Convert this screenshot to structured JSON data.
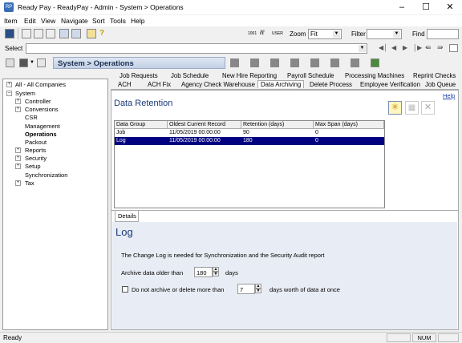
{
  "window": {
    "title": "Ready Pay - ReadyPay - Admin - System > Operations"
  },
  "menu": [
    "Item",
    "Edit",
    "View",
    "Navigate",
    "Sort",
    "Tools",
    "Help"
  ],
  "toolbar": {
    "zoom_label": "Zoom",
    "zoom_value": "Fit",
    "filter_label": "Filter",
    "filter_value": "",
    "find_label": "Find",
    "find_value": "",
    "id_badge": "1001",
    "user_badge": "USER"
  },
  "select_bar": {
    "label": "Select",
    "value": ""
  },
  "breadcrumb": "System > Operations",
  "tree": [
    {
      "label": "All - All Companies",
      "level": 0,
      "expander": "+"
    },
    {
      "label": "System",
      "level": 0,
      "expander": "-"
    },
    {
      "label": "Controller",
      "level": 1,
      "expander": "+"
    },
    {
      "label": "Conversions",
      "level": 1,
      "expander": "+"
    },
    {
      "label": "CSR",
      "level": 1,
      "expander": ""
    },
    {
      "label": "Management",
      "level": 1,
      "expander": ""
    },
    {
      "label": "Operations",
      "level": 1,
      "expander": "",
      "selected": true
    },
    {
      "label": "Packout",
      "level": 1,
      "expander": ""
    },
    {
      "label": "Reports",
      "level": 1,
      "expander": "+"
    },
    {
      "label": "Security",
      "level": 1,
      "expander": "+"
    },
    {
      "label": "Setup",
      "level": 1,
      "expander": "+"
    },
    {
      "label": "Synchronization",
      "level": 1,
      "expander": ""
    },
    {
      "label": "Tax",
      "level": 1,
      "expander": "+"
    }
  ],
  "tabs_top": [
    "Job Requests",
    "Job Schedule",
    "New Hire Reporting",
    "Payroll Schedule",
    "Processing Machines",
    "Reprint Checks"
  ],
  "tabs_bottom": [
    "ACH",
    "ACH Fix",
    "Agency Check Warehouse",
    "Data Archiving",
    "Delete Process",
    "Employee Verification",
    "Job Queue"
  ],
  "active_tab": "Data Archiving",
  "help_link": "Help",
  "section_title": "Data Retention",
  "grid": {
    "columns": [
      "Data Group",
      "Oldest Current Record",
      "Retention (days)",
      "Max Span (days)"
    ],
    "rows": [
      [
        "Job",
        "11/05/2019 00:00:00",
        "90",
        "0"
      ],
      [
        "Log",
        "11/05/2019 00:00:00",
        "180",
        "0"
      ]
    ],
    "selected_row": 1
  },
  "details": {
    "tab_label": "Details",
    "title": "Log",
    "description": "The Change Log is needed for Synchronization and the Security Audit report",
    "archive_label": "Archive data older than",
    "archive_value": "180",
    "archive_unit": "days",
    "checkbox_label": "Do not archive or delete more than",
    "checkbox_checked": false,
    "span_value": "7",
    "span_unit": "days worth of data at once"
  },
  "status": {
    "left": "Ready",
    "num": "NUM"
  }
}
